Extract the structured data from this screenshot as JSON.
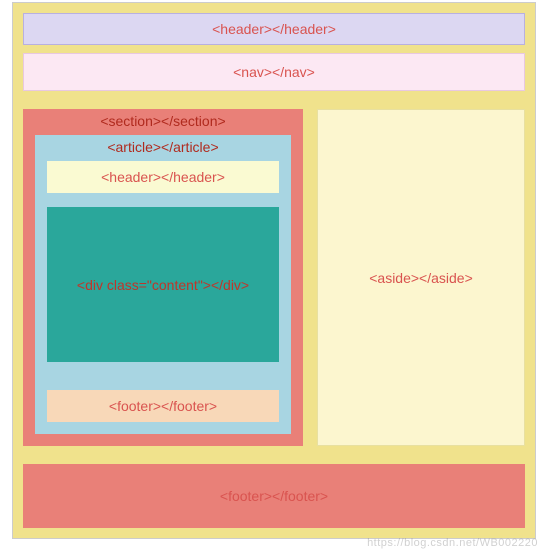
{
  "header_label": "<header></header>",
  "nav_label": "<nav></nav>",
  "section_label": "<section></section>",
  "article_label": "<article></article>",
  "article_header_label": "<header></header>",
  "content_label": "<div class=\"content\"></div>",
  "article_footer_label": "<footer></footer>",
  "aside_label": "<aside></aside>",
  "page_footer_label": "<footer></footer>",
  "watermark_text": "https://blog.csdn.net/WB002220"
}
